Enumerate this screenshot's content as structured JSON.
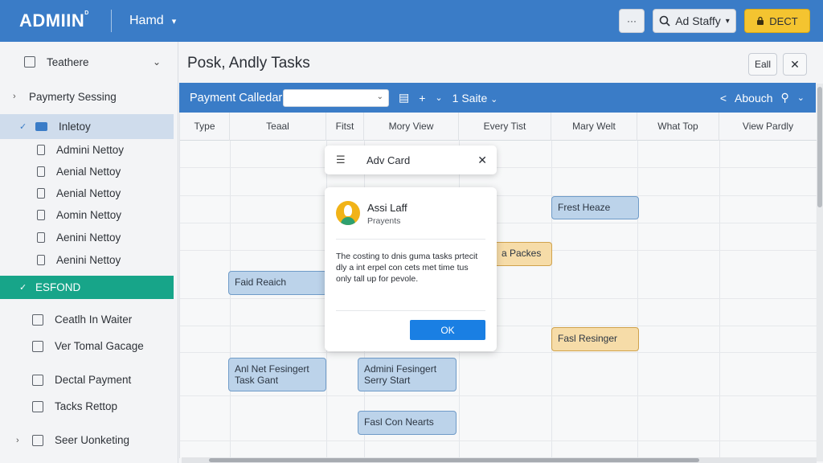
{
  "app": {
    "logo": "ADMIIN",
    "logo_mark": "D",
    "home_label": "Hamd",
    "user_label": "Ad Staffy",
    "dect_label": "DECT",
    "dots_label": "···"
  },
  "sidebar": {
    "header": "Teathere",
    "items": [
      {
        "label": "Paymerty Sessing"
      },
      {
        "label": "Inletoy"
      },
      {
        "label": "Admini Nettoy"
      },
      {
        "label": "Aenial Nettoy"
      },
      {
        "label": "Aenial Nettoy"
      },
      {
        "label": "Aomin Nettoy"
      },
      {
        "label": "Aenini Nettoy"
      },
      {
        "label": "Aenini Nettoy"
      },
      {
        "label": "ESFOND"
      },
      {
        "label": "Ceatlh In Waiter"
      },
      {
        "label": "Ver Tomal Gacage"
      },
      {
        "label": "Dectal Payment"
      },
      {
        "label": "Tacks Rettop"
      },
      {
        "label": "Seer Uonketing"
      }
    ]
  },
  "main": {
    "title": "Posk, Andly Tasks",
    "edit_all": "Eall",
    "close": "✕",
    "calendar_title": "Payment Calledar",
    "view_label": "1 Saite",
    "about_label": "Abouch"
  },
  "grid": {
    "columns": [
      "Type",
      "Teaal",
      "Fitst",
      "Mory View",
      "Every Tist",
      "Mary Welt",
      "What Top",
      "View Pardly"
    ],
    "cards": [
      {
        "text": "Frest Heaze"
      },
      {
        "text": "a Packes"
      },
      {
        "text": "Faid Reaich"
      },
      {
        "text": "Fasl Resinger"
      },
      {
        "text": "Anl Net Fesingert Task Gant"
      },
      {
        "text": "Admini Fesingert Serry Start"
      },
      {
        "text": "Fasl Con Nearts"
      }
    ]
  },
  "dialog_card": {
    "title": "Adv Card"
  },
  "modal": {
    "name": "Assi Laff",
    "subtitle": "Prayents",
    "body": "The costing to dnis guma tasks prtecit dly a int erpel con cets met time tus only tall up for pevole.",
    "ok": "OK"
  },
  "colors": {
    "header_blue": "#3a7cc7",
    "accent_green": "#17a589",
    "button_yellow": "#f4c430",
    "ok_blue": "#1a7fe3"
  }
}
